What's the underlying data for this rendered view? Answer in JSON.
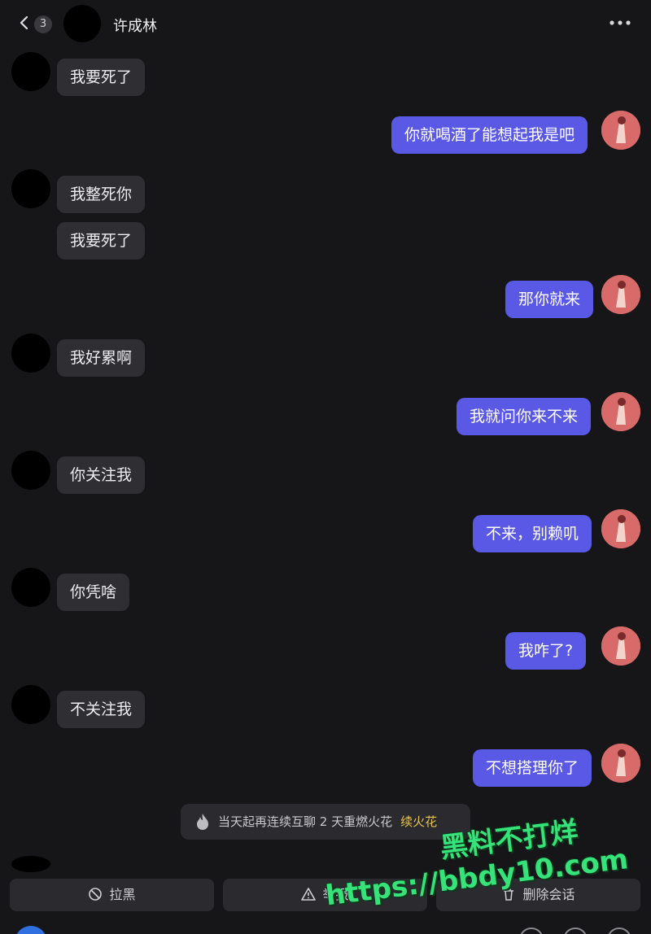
{
  "header": {
    "unread_count": "3",
    "title": "许成林"
  },
  "messages": [
    {
      "side": "in",
      "text": "我要死了"
    },
    {
      "side": "out",
      "text": "你就喝酒了能想起我是吧"
    },
    {
      "side": "in",
      "text": "我整死你"
    },
    {
      "side": "in",
      "text": "我要死了"
    },
    {
      "side": "out",
      "text": "那你就来"
    },
    {
      "side": "in",
      "text": "我好累啊"
    },
    {
      "side": "out",
      "text": "我就问你来不来"
    },
    {
      "side": "in",
      "text": "你关注我"
    },
    {
      "side": "out",
      "text": "不来，别赖叽"
    },
    {
      "side": "in",
      "text": "你凭啥"
    },
    {
      "side": "out",
      "text": "我咋了?"
    },
    {
      "side": "in",
      "text": "不关注我"
    },
    {
      "side": "out",
      "text": "不想搭理你了"
    }
  ],
  "notice": {
    "text": "当天起再连续互聊 2 天重燃火花",
    "link": "续火花",
    "link_color": "#e8c34a"
  },
  "actions": {
    "block_label": "拉黑",
    "report_label": "举报",
    "delete_label": "删除会话"
  },
  "watermark": {
    "line1": "黑料不打烊",
    "line2": "https://bbdy10.com"
  },
  "colors": {
    "outgoing_bubble": "#5a59e6",
    "incoming_bubble": "#2f2f33",
    "background": "#161618",
    "watermark": "#37e27a"
  }
}
